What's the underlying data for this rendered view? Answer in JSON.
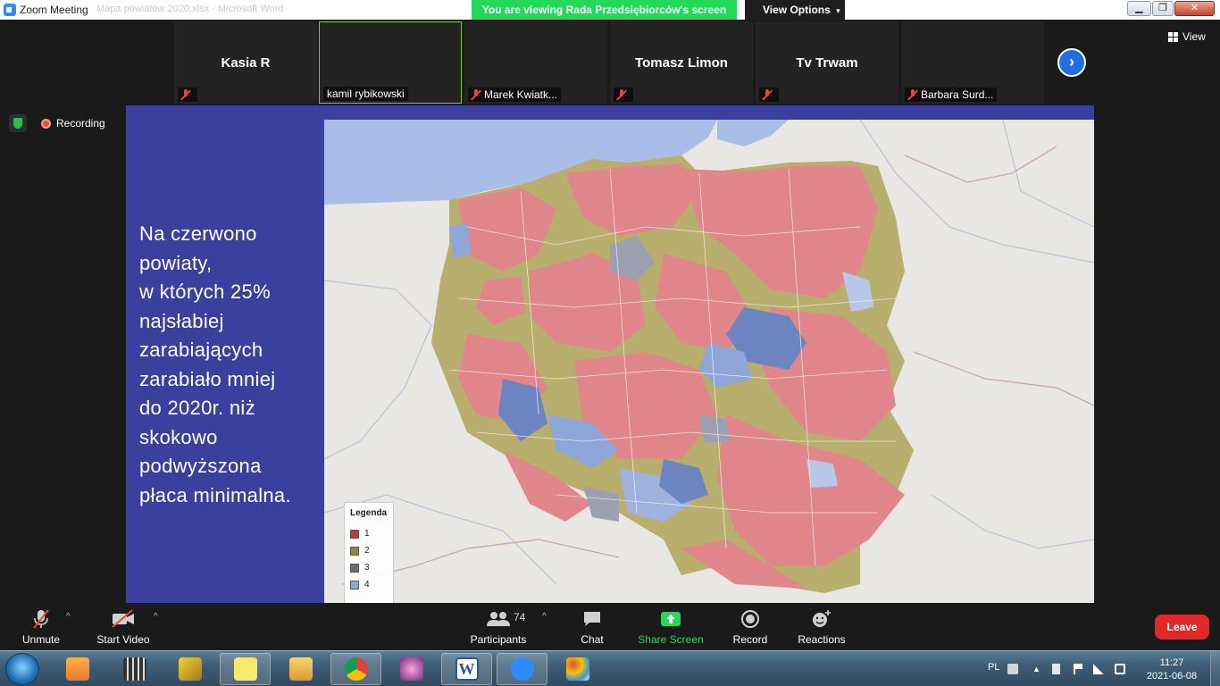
{
  "window": {
    "title": "Zoom Meeting",
    "ghost_title": "Mapa powiatów 2020.xlsx - Microsoft Word",
    "banner": "You are viewing Rada Przedsiębiorców's screen",
    "view_options": "View Options",
    "minimize": "▁",
    "maximize": "❐",
    "close": "✕"
  },
  "gallery": {
    "tiles": [
      {
        "name": "Kasia R",
        "footer": ""
      },
      {
        "name": "",
        "footer": "kamil rybikowski"
      },
      {
        "name": "",
        "footer": "Marek Kwiatk..."
      },
      {
        "name": "Tomasz Limon",
        "footer": ""
      },
      {
        "name": "Tv Trwam",
        "footer": ""
      },
      {
        "name": "",
        "footer": "Barbara Surd..."
      }
    ],
    "next": "›",
    "view_label": "View"
  },
  "status": {
    "recording": "Recording"
  },
  "slide": {
    "text": "Na czerwono\npowiaty,\nw których 25%\nnajsłabiej\nzarabiających\nzarabiało mniej\ndo 2020r. niż\nskokowo\npodwyższona\npłaca minimalna."
  },
  "legend": {
    "title": "Legenda",
    "items": [
      {
        "label": "1",
        "color": "#b83a3a"
      },
      {
        "label": "2",
        "color": "#8e8a3a"
      },
      {
        "label": "3",
        "color": "#6d6d6d"
      },
      {
        "label": "4",
        "color": "#8fa6d8"
      }
    ]
  },
  "controls": {
    "unmute": "Unmute",
    "start_video": "Start Video",
    "participants": "Participants",
    "participants_count": "74",
    "chat": "Chat",
    "share_screen": "Share Screen",
    "record": "Record",
    "reactions": "Reactions",
    "leave": "Leave",
    "caret": "^"
  },
  "taskbar": {
    "lang": "PL",
    "time": "11:27",
    "date": "2021-06-08"
  },
  "colors": {
    "accent_green": "#23d959",
    "zoom_blue": "#2d8cff",
    "leave_red": "#e02828",
    "slide_bg": "#3b3f9e",
    "map_red": "#e1878c",
    "map_olive": "#b8ae6e",
    "map_blue": "#6c84c0"
  }
}
